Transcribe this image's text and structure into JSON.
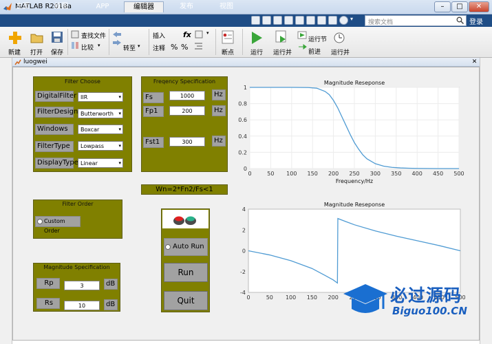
{
  "app": {
    "title": "MATLAB R2018a"
  },
  "tabs": [
    {
      "label": "主页"
    },
    {
      "label": "绘图"
    },
    {
      "label": "APP"
    },
    {
      "label": "编辑器"
    },
    {
      "label": "发布"
    },
    {
      "label": "视图"
    }
  ],
  "search": {
    "placeholder": "搜索文档"
  },
  "login": "登录",
  "toolstrip": {
    "new": "新建",
    "open": "打开",
    "save": "保存",
    "find_files": "查找文件",
    "compare": "比较",
    "goto": "转至",
    "insert": "插入",
    "comment": "注释",
    "fx": "fx",
    "breakpoint": "断点",
    "run": "运行",
    "run_advance": "运行并",
    "run_section": "运行节",
    "advance": "前进",
    "run_time": "运行并"
  },
  "figure": {
    "title": "luogwei"
  },
  "filter_choose": {
    "title": "Filter Choose",
    "rows": [
      {
        "label": "DigitalFilter",
        "value": "IIR"
      },
      {
        "label": "FilterDesign",
        "value": "Butterworth"
      },
      {
        "label": "Windows",
        "value": "Boxcar"
      },
      {
        "label": "FilterType",
        "value": "Lowpass"
      },
      {
        "label": "DisplayType",
        "value": "Linear"
      }
    ]
  },
  "freq_spec": {
    "title": "Freqency Specification",
    "fs_label": "Fs",
    "fs_value": "1000",
    "fs_unit": "Hz",
    "fp1_label": "Fp1",
    "fp1_value": "200",
    "fp1_unit": "Hz",
    "fst1_label": "Fst1",
    "fst1_value": "300",
    "fst1_unit": "Hz"
  },
  "wn_text": "Wn=2*Fn2/Fs<1",
  "filter_order": {
    "title": "Filter Order",
    "custom_label": "Custom Order"
  },
  "mag_spec": {
    "title": "Magnitude  Specification",
    "rp_label": "Rp",
    "rp_value": "3",
    "rp_unit": "dB",
    "rs_label": "Rs",
    "rs_value": "10",
    "rs_unit": "dB"
  },
  "controls": {
    "auto_run": "Auto Run",
    "run": "Run",
    "quit": "Quit"
  },
  "watermark": {
    "line1": "必过源码",
    "line2": "Biguo100.CN"
  },
  "chart_data": [
    {
      "type": "line",
      "title": "Magnitude Reseponse",
      "xlabel": "Frequency/Hz",
      "ylabel": "",
      "xlim": [
        0,
        500
      ],
      "ylim": [
        0,
        1
      ],
      "xticks": [
        0,
        50,
        100,
        150,
        200,
        250,
        300,
        350,
        400,
        450,
        500
      ],
      "yticks": [
        0,
        0.2,
        0.4,
        0.6,
        0.8,
        1
      ],
      "grid": true,
      "color": "#4f9bd3",
      "series": [
        {
          "x": [
            0,
            50,
            100,
            140,
            160,
            180,
            190,
            200,
            210,
            220,
            230,
            240,
            250,
            260,
            270,
            280,
            300,
            320,
            340,
            360,
            380,
            400,
            450,
            500
          ],
          "y": [
            1,
            1,
            1,
            0.998,
            0.99,
            0.95,
            0.91,
            0.84,
            0.75,
            0.64,
            0.53,
            0.42,
            0.32,
            0.24,
            0.17,
            0.12,
            0.06,
            0.03,
            0.015,
            0.008,
            0.004,
            0.002,
            0,
            0
          ]
        }
      ]
    },
    {
      "type": "line",
      "title": "Magnitude Reseponse",
      "xlabel": "Freq",
      "ylabel": "",
      "xlim": [
        0,
        500
      ],
      "ylim": [
        -4,
        4
      ],
      "xticks": [
        0,
        50,
        100,
        150,
        200,
        250,
        300,
        350,
        400,
        450,
        500
      ],
      "yticks": [
        -4,
        -2,
        0,
        2,
        4
      ],
      "grid": false,
      "color": "#4f9bd3",
      "series": [
        {
          "x": [
            0,
            50,
            100,
            150,
            180,
            200,
            210,
            211,
            230,
            250,
            300,
            350,
            400,
            450,
            500
          ],
          "y": [
            0,
            -0.4,
            -0.95,
            -1.7,
            -2.35,
            -2.8,
            -3.1,
            3.1,
            2.8,
            2.5,
            1.9,
            1.4,
            0.95,
            0.5,
            0
          ]
        }
      ]
    }
  ]
}
